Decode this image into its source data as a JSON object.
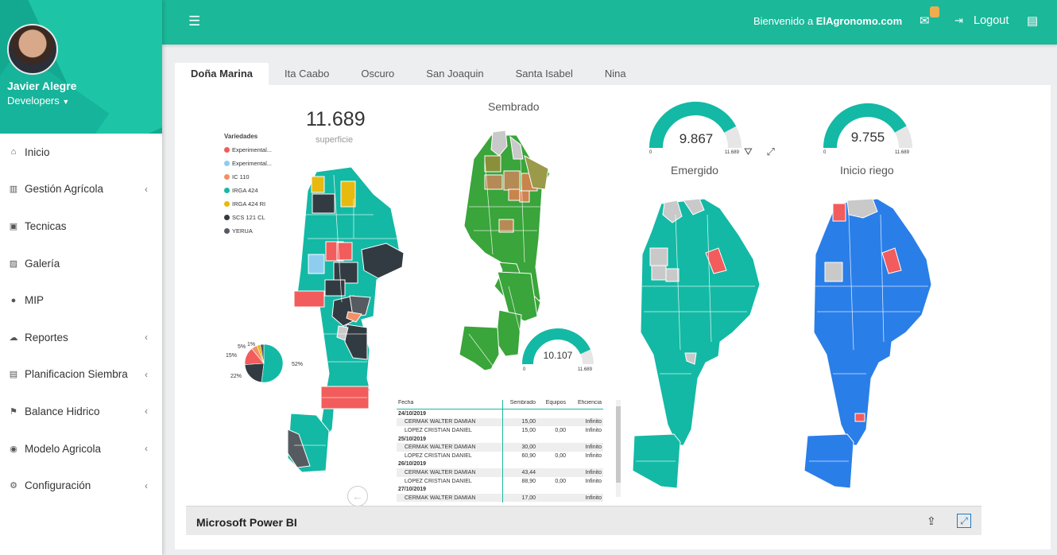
{
  "user": {
    "name": "Javier Alegre",
    "role": "Developers"
  },
  "sidebar": {
    "items": [
      {
        "label": "Inicio",
        "icon": "home-icon",
        "glyph": "⌂",
        "has_sub": false
      },
      {
        "label": "Gestión Agrícola",
        "icon": "bar-chart-icon",
        "glyph": "▥",
        "has_sub": true
      },
      {
        "label": "Tecnicas",
        "icon": "book-icon",
        "glyph": "▣",
        "has_sub": false
      },
      {
        "label": "Galería",
        "icon": "image-icon",
        "glyph": "▨",
        "has_sub": false
      },
      {
        "label": "MIP",
        "icon": "comments-icon",
        "glyph": "●",
        "has_sub": false
      },
      {
        "label": "Reportes",
        "icon": "cloud-download-icon",
        "glyph": "☁",
        "has_sub": true
      },
      {
        "label": "Planificacion Siembra",
        "icon": "calendar-icon",
        "glyph": "▤",
        "has_sub": true
      },
      {
        "label": "Balance Hidrico",
        "icon": "flag-icon",
        "glyph": "⚑",
        "has_sub": true
      },
      {
        "label": "Modelo Agricola",
        "icon": "compass-icon",
        "glyph": "◉",
        "has_sub": true
      },
      {
        "label": "Configuración",
        "icon": "cogs-icon",
        "glyph": "⚙",
        "has_sub": true
      }
    ]
  },
  "topbar": {
    "welcome_prefix": "Bienvenido a",
    "site": "ElAgronomo.com",
    "mail_badge": "",
    "logout_label": "Logout"
  },
  "tabs": [
    "Doña Marina",
    "Ita Caabo",
    "Oscuro",
    "San Joaquin",
    "Santa Isabel",
    "Nina"
  ],
  "active_tab": 0,
  "report": {
    "superficie_value": "11.689",
    "superficie_label": "superficie",
    "legend_title": "Variedades",
    "varieties": [
      {
        "name": "Experimental...",
        "color": "#f25c5c"
      },
      {
        "name": "Experimental...",
        "color": "#8ecdf0"
      },
      {
        "name": "IC 110",
        "color": "#f29068"
      },
      {
        "name": "IRGA 424",
        "color": "#13b9a5"
      },
      {
        "name": "IRGA 424 RI",
        "color": "#e8b90f"
      },
      {
        "name": "SCS 121 CL",
        "color": "#333b42"
      },
      {
        "name": "YERUA",
        "color": "#555b60"
      }
    ],
    "pie": {
      "slices": [
        52,
        22,
        15,
        5,
        3,
        3
      ],
      "labels": [
        "52%",
        "22%",
        "15%",
        "5%",
        "1%",
        "3%"
      ]
    },
    "sembrado": {
      "title": "Sembrado",
      "value": "10.107",
      "min": "0",
      "max": "11.689",
      "fraction": 0.865
    },
    "emergido": {
      "title": "Emergido",
      "value": "9.867",
      "min": "0",
      "max": "11.689",
      "fraction": 0.844
    },
    "inicio_riego": {
      "title": "Inicio riego",
      "value": "9.755",
      "min": "0",
      "max": "11.689",
      "fraction": 0.835
    },
    "table": {
      "headers": [
        "Fecha",
        "Sembrado",
        "Equipos",
        "Eficiencia"
      ],
      "rows": [
        {
          "type": "group",
          "label": "24/10/2019"
        },
        {
          "type": "row",
          "name": "CERMAK WALTER DAMIAN",
          "sembrado": "15,00",
          "equipos": "",
          "eficiencia": "Infinito"
        },
        {
          "type": "row",
          "name": "LOPEZ CRISTIAN DANIEL",
          "sembrado": "15,00",
          "equipos": "0,00",
          "eficiencia": "Infinito"
        },
        {
          "type": "group",
          "label": "25/10/2019"
        },
        {
          "type": "row",
          "name": "CERMAK WALTER DAMIAN",
          "sembrado": "30,00",
          "equipos": "",
          "eficiencia": "Infinito"
        },
        {
          "type": "row",
          "name": "LOPEZ CRISTIAN DANIEL",
          "sembrado": "60,90",
          "equipos": "0,00",
          "eficiencia": "Infinito"
        },
        {
          "type": "group",
          "label": "26/10/2019"
        },
        {
          "type": "row",
          "name": "CERMAK WALTER DAMIAN",
          "sembrado": "43,44",
          "equipos": "",
          "eficiencia": "Infinito"
        },
        {
          "type": "row",
          "name": "LOPEZ CRISTIAN DANIEL",
          "sembrado": "88,90",
          "equipos": "0,00",
          "eficiencia": "Infinito"
        },
        {
          "type": "group",
          "label": "27/10/2019"
        },
        {
          "type": "row",
          "name": "CERMAK WALTER DAMIAN",
          "sembrado": "17,00",
          "equipos": "",
          "eficiencia": "Infinito"
        }
      ]
    }
  },
  "footer": {
    "label": "Microsoft Power BI"
  },
  "colors": {
    "teal": "#1bb89a",
    "gauge": "#13b9a5",
    "green": "#3aa53a",
    "blue": "#2a7ee8",
    "red": "#f25c5c",
    "gray": "#c9c9c9"
  }
}
